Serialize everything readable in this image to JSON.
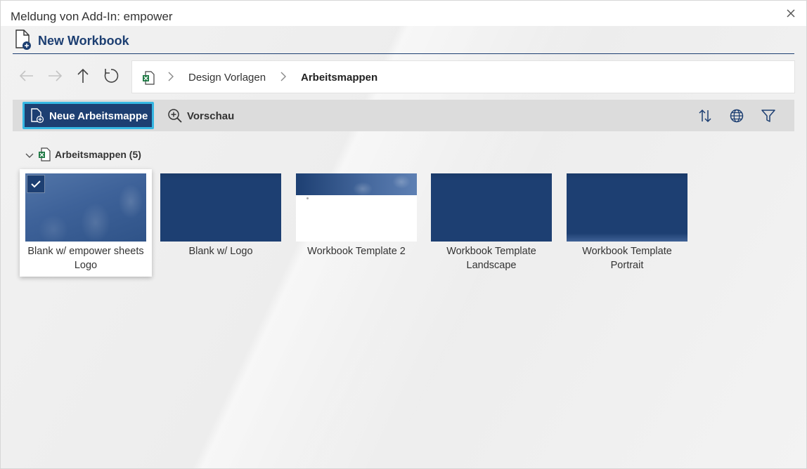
{
  "window": {
    "title": "Meldung von Add-In: empower",
    "close_icon": "close-icon"
  },
  "header": {
    "title": "New Workbook",
    "icon": "new-document-icon"
  },
  "nav": {
    "back_icon": "arrow-left-icon",
    "forward_icon": "arrow-right-icon",
    "up_icon": "arrow-up-icon",
    "refresh_icon": "refresh-icon"
  },
  "breadcrumb": {
    "root_icon": "excel-icon",
    "items": [
      "Design Vorlagen",
      "Arbeitsmappen"
    ]
  },
  "toolbar": {
    "new_label": "Neue Arbeitsmappe",
    "preview_label": "Vorschau",
    "sort_icon": "sort-icon",
    "language_icon": "globe-icon",
    "filter_icon": "filter-icon"
  },
  "group": {
    "label": "Arbeitsmappen (5)"
  },
  "templates": [
    {
      "line1": "Blank w/ empower sheets",
      "line2": "Logo",
      "selected": true
    },
    {
      "line1": "Blank w/ Logo",
      "line2": "",
      "selected": false
    },
    {
      "line1": "Workbook Template 2",
      "line2": "",
      "selected": false
    },
    {
      "line1": "Workbook Template",
      "line2": "Landscape",
      "selected": false
    },
    {
      "line1": "Workbook Template",
      "line2": "Portrait",
      "selected": false
    }
  ],
  "colors": {
    "brand": "#1d3f72",
    "focus_ring": "#36b7e3",
    "excel_green": "#1f7a45"
  }
}
